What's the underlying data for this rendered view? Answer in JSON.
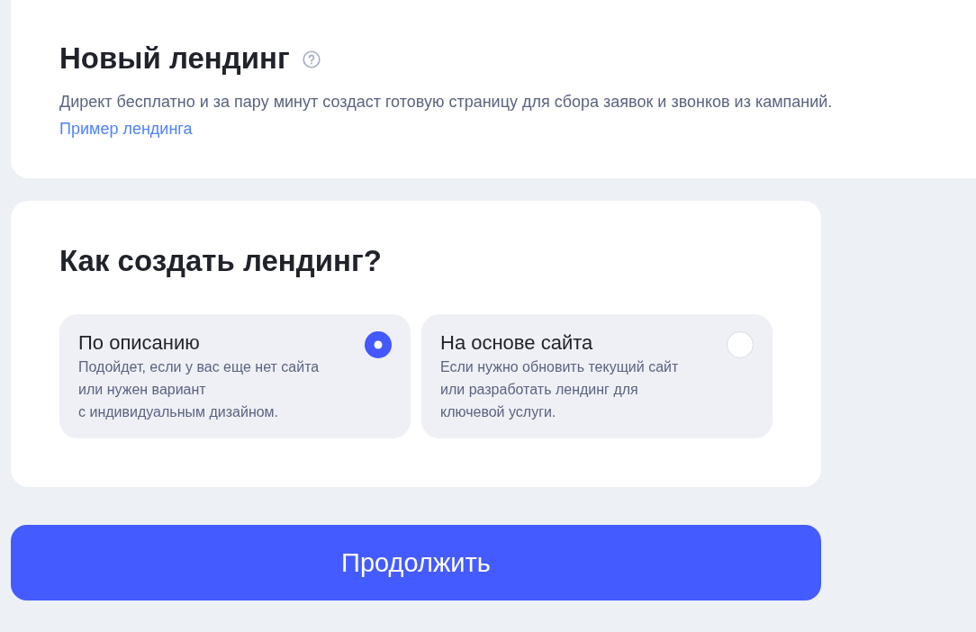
{
  "header": {
    "title": "Новый лендинг",
    "description": "Директ бесплатно и за пару минут создаст готовую страницу для сбора заявок и звонков из кампаний.",
    "link": "Пример лендинга"
  },
  "method": {
    "title": "Как создать лендинг?",
    "options": [
      {
        "title": "По описанию",
        "description_lines": [
          "Подойдет, если у вас еще нет сайта",
          "или нужен вариант",
          "с индивидуальным дизайном."
        ],
        "selected": true
      },
      {
        "title": "На основе сайта",
        "description_lines": [
          "Если нужно обновить текущий сайт",
          "или разработать лендинг для",
          "ключевой услуги."
        ],
        "selected": false
      }
    ]
  },
  "continue_button": "Продолжить"
}
